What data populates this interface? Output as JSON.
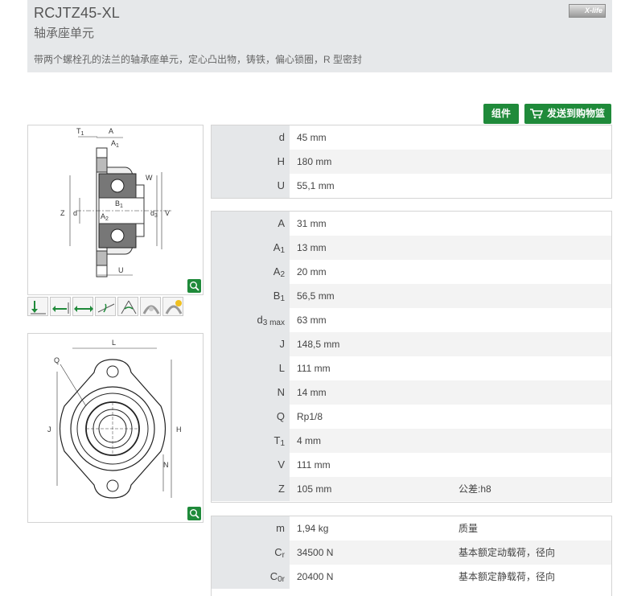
{
  "header": {
    "title": "RCJTZ45-XL",
    "subtitle": "轴承座单元",
    "description": "带两个螺栓孔的法兰的轴承座单元，定心凸出物，铸铁，偏心锁圈，R 型密封",
    "brand": "X-life"
  },
  "buttons": {
    "kit": "组件",
    "cart": "发送到购物篮"
  },
  "colors": {
    "accent_green": "#1f8a3a",
    "header_bg": "#e6e8ea"
  },
  "table1": [
    {
      "label": "d",
      "value": "45  mm"
    },
    {
      "label": "H",
      "value": "180  mm"
    },
    {
      "label": "U",
      "value": "55,1  mm"
    }
  ],
  "table2": [
    {
      "label": "A",
      "sub": "",
      "value": "31  mm",
      "note": ""
    },
    {
      "label": "A",
      "sub": "1",
      "value": "13  mm",
      "note": ""
    },
    {
      "label": "A",
      "sub": "2",
      "value": "20  mm",
      "note": ""
    },
    {
      "label": "B",
      "sub": "1",
      "value": "56,5  mm",
      "note": ""
    },
    {
      "label": "d",
      "sub": "3 max",
      "value": "63  mm",
      "note": ""
    },
    {
      "label": "J",
      "sub": "",
      "value": "148,5  mm",
      "note": ""
    },
    {
      "label": "L",
      "sub": "",
      "value": "111  mm",
      "note": ""
    },
    {
      "label": "N",
      "sub": "",
      "value": "14  mm",
      "note": ""
    },
    {
      "label": "Q",
      "sub": "",
      "value": "Rp1/8",
      "note": ""
    },
    {
      "label": "T",
      "sub": "1",
      "value": "4  mm",
      "note": ""
    },
    {
      "label": "V",
      "sub": "",
      "value": "111  mm",
      "note": ""
    },
    {
      "label": "Z",
      "sub": "",
      "value": "105  mm",
      "note": "公差:h8"
    }
  ],
  "table3": [
    {
      "label": "m",
      "sub": "",
      "value": "1,94  kg",
      "note": "质量"
    },
    {
      "label": "C",
      "sub": "r",
      "value": "34500  N",
      "note": "基本额定动载荷，径向"
    },
    {
      "label": "C",
      "sub": "0r",
      "value": "20400  N",
      "note": "基本额定静载荷，径向"
    }
  ],
  "drawing1_labels": {
    "T1": "T",
    "T1sub": "1",
    "A": "A",
    "A1": "A",
    "A1sub": "1",
    "W": "W",
    "Z": "Z",
    "d": "d",
    "B1": "B",
    "B1sub": "1",
    "A2": "A",
    "A2sub": "2",
    "d3": "d",
    "d3sub": "3",
    "V": "V",
    "U": "U"
  },
  "drawing2_labels": {
    "L": "L",
    "Q": "Q",
    "J": "J",
    "H": "H",
    "N": "N"
  },
  "load_icons": [
    "radial-load-icon",
    "axial-load-left-icon",
    "axial-load-both-icon",
    "misalignment-icon",
    "angular-icon",
    "seal-icon",
    "temperature-icon"
  ]
}
